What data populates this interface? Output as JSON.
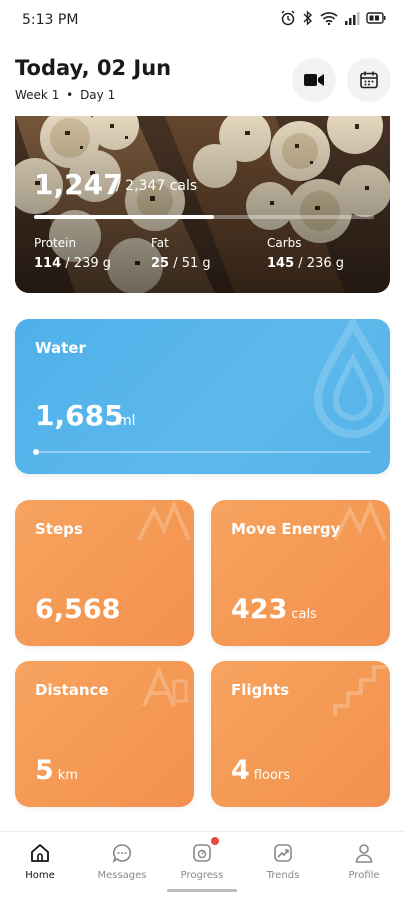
{
  "status_bar": {
    "time": "5:13 PM"
  },
  "header": {
    "title": "Today, 02 Jun",
    "week": "Week 1",
    "separator": "•",
    "day": "Day 1"
  },
  "calories": {
    "eaten": "1,247",
    "total_text": "/ 2,347 cals",
    "progress": 0.53,
    "macros": [
      {
        "label": "Protein",
        "value": "114",
        "total": "/ 239 g"
      },
      {
        "label": "Fat",
        "value": "25",
        "total": "/ 51 g"
      },
      {
        "label": "Carbs",
        "value": "145",
        "total": "/ 236 g"
      }
    ]
  },
  "water": {
    "title": "Water",
    "value": "1,685",
    "unit": "ml",
    "progress": 0.0
  },
  "tiles": [
    {
      "title": "Steps",
      "value": "6,568",
      "unit": ""
    },
    {
      "title": "Move Energy",
      "value": "423",
      "unit": "cals"
    },
    {
      "title": "Distance",
      "value": "5",
      "unit": "km"
    },
    {
      "title": "Flights",
      "value": "4",
      "unit": "floors"
    }
  ],
  "tabs": [
    {
      "label": "Home",
      "icon": "home-icon",
      "active": true
    },
    {
      "label": "Messages",
      "icon": "chat-icon",
      "active": false
    },
    {
      "label": "Progress",
      "icon": "scale-icon",
      "active": false
    },
    {
      "label": "Trends",
      "icon": "trend-icon",
      "active": false
    },
    {
      "label": "Profile",
      "icon": "person-icon",
      "active": false
    }
  ],
  "colors": {
    "water": "#55b3e8",
    "tile_orange": "#f49a55",
    "badge": "#e94a3b"
  }
}
